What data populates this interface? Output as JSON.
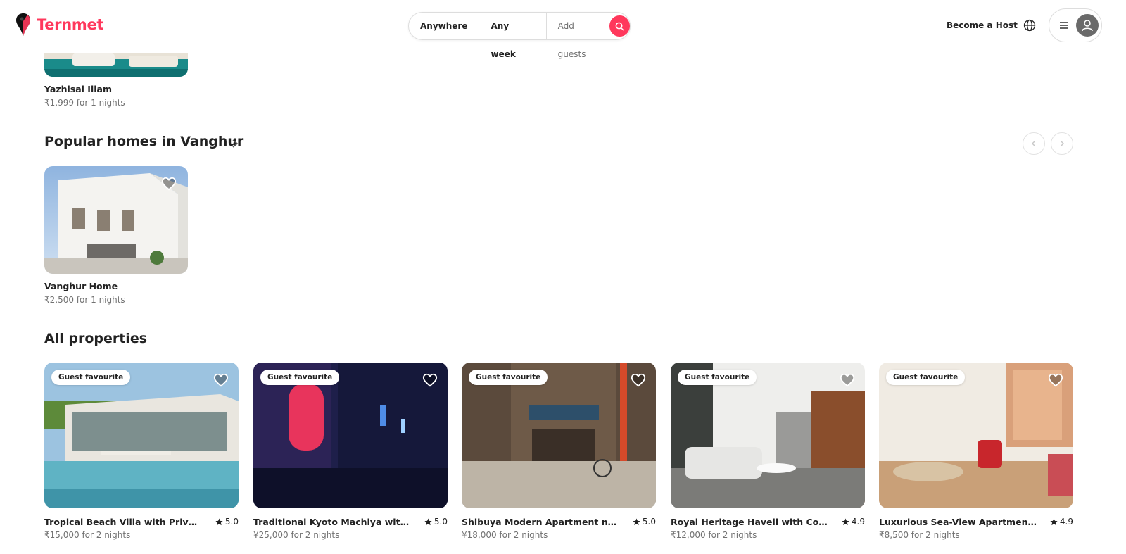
{
  "header": {
    "brand": "Ternmet",
    "search": {
      "where": "Anywhere",
      "when": "Any week",
      "guests": "Add guests"
    },
    "become_host": "Become a Host"
  },
  "top_listing": {
    "title": "Yazhisai Illam",
    "price": "₹1,999 for 1 nights"
  },
  "popular_section": {
    "title": "Popular homes in Vanghur",
    "items": [
      {
        "title": "Vanghur Home",
        "price": "₹2,500 for 1 nights"
      }
    ]
  },
  "all_properties": {
    "title": "All properties",
    "items": [
      {
        "badge": "Guest favourite",
        "title": "Tropical Beach Villa with Private Pool i...",
        "rating": "5.0",
        "price": "₹15,000 for 2 nights"
      },
      {
        "badge": "Guest favourite",
        "title": "Traditional Kyoto Machiya with Zen...",
        "rating": "5.0",
        "price": "¥25,000 for 2 nights"
      },
      {
        "badge": "Guest favourite",
        "title": "Shibuya Modern Apartment near...",
        "rating": "5.0",
        "price": "¥18,000 for 2 nights"
      },
      {
        "badge": "Guest favourite",
        "title": "Royal Heritage Haveli with Courtyard i...",
        "rating": "4.9",
        "price": "₹12,000 for 2 nights"
      },
      {
        "badge": "Guest favourite",
        "title": "Luxurious Sea-View Apartment in...",
        "rating": "4.9",
        "price": "₹8,500 for 2 nights"
      }
    ]
  },
  "colors": {
    "brand": "#ff385c",
    "text": "#222222",
    "muted": "#717171"
  },
  "icons": [
    "map-pin-logo-icon",
    "search-icon",
    "globe-icon",
    "menu-icon",
    "user-icon",
    "chevron-right-icon",
    "chevron-left-icon",
    "heart-icon",
    "star-icon"
  ]
}
